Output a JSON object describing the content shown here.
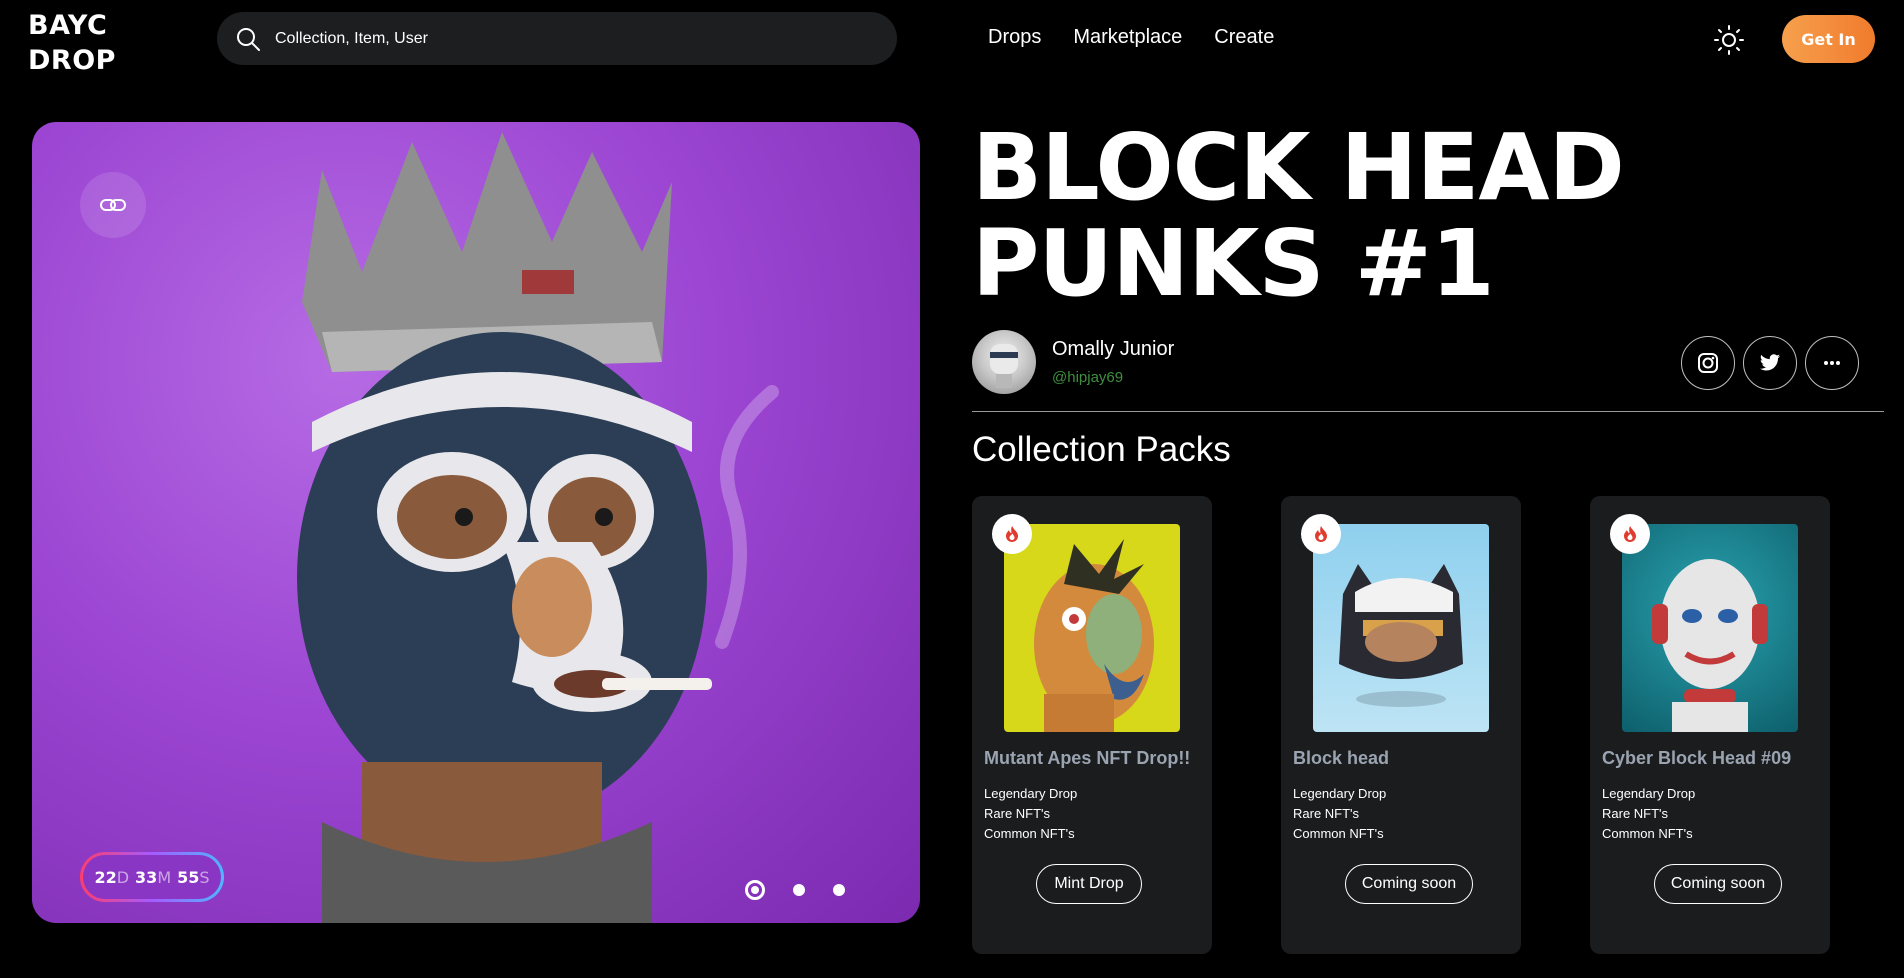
{
  "brand": {
    "line1": "BAYC",
    "line2": "DROP"
  },
  "search": {
    "placeholder": "Collection, Item, User"
  },
  "nav": {
    "items": [
      "Drops",
      "Marketplace",
      "Create"
    ]
  },
  "header": {
    "cta_label": "Get In",
    "theme_icon": "sun-icon"
  },
  "hero": {
    "timer": {
      "days": "22",
      "days_unit": "D",
      "minutes": "33",
      "minutes_unit": "M",
      "seconds": "55",
      "seconds_unit": "S"
    },
    "slides_count": 3,
    "active_slide": 1
  },
  "drop": {
    "title_line1": "BLOCK HEAD",
    "title_line2": "PUNKS #1"
  },
  "author": {
    "name": "Omally Junior",
    "handle": "@hipjay69"
  },
  "socials": [
    "instagram-icon",
    "twitter-icon",
    "more-icon"
  ],
  "collection": {
    "heading": "Collection Packs",
    "packs": [
      {
        "title": "Mutant Apes NFT Drop!!",
        "lines": [
          "Legendary Drop",
          "Rare NFT's",
          "Common NFT's"
        ],
        "button": "Mint Drop"
      },
      {
        "title": "Block head",
        "lines": [
          "Legendary Drop",
          "Rare NFT's",
          "Common NFT's"
        ],
        "button": "Coming soon"
      },
      {
        "title": "Cyber Block Head #09",
        "lines": [
          "Legendary Drop",
          "Rare NFT's",
          "Common NFT's"
        ],
        "button": "Coming soon"
      }
    ]
  },
  "colors": {
    "accent": "#f28b3a",
    "hero_bg": "#9c46d3",
    "card_bg": "#1b1c1e",
    "handle": "#3f8f3f",
    "fire": "#e03b2f"
  }
}
